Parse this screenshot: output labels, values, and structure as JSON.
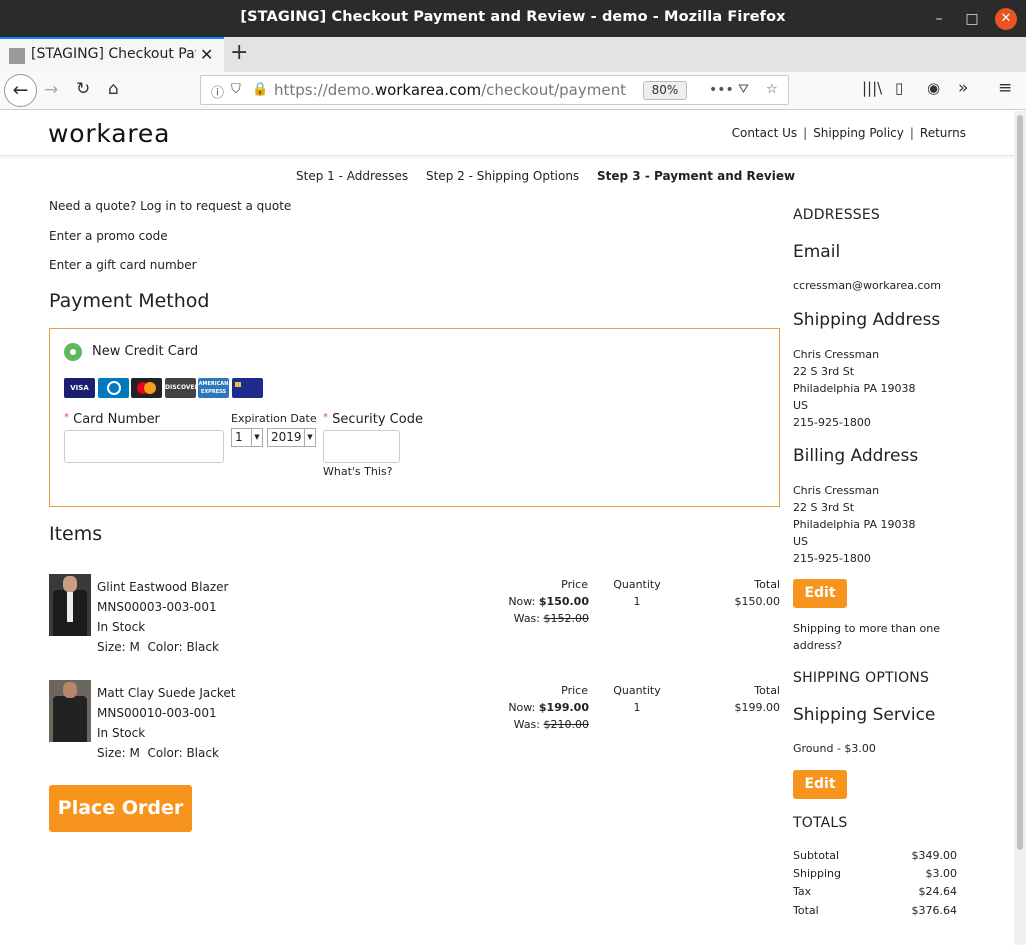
{
  "window": {
    "title": "[STAGING] Checkout Payment and Review - demo - Mozilla Firefox",
    "tab_label": "[STAGING] Checkout Pay",
    "url_prefix": "https://demo.",
    "url_domain": "workarea.com",
    "url_path": "/checkout/payment",
    "zoom": "80%"
  },
  "header": {
    "logo": "workarea",
    "links": [
      "Contact Us",
      "Shipping Policy",
      "Returns"
    ]
  },
  "steps": [
    "Step 1 - Addresses",
    "Step 2 - Shipping Options",
    "Step 3 - Payment and Review"
  ],
  "links": {
    "quote": "Need a quote? Log in to request a quote",
    "promo": "Enter a promo code",
    "gift": "Enter a gift card number"
  },
  "payment": {
    "title": "Payment Method",
    "option": "New Credit Card",
    "cards": [
      "VISA",
      "Diners",
      "Mastercard",
      "DISCOVER",
      "AMERICAN EXPRESS",
      "Card"
    ],
    "card_number_label": "Card Number",
    "expiration_label": "Expiration Date",
    "exp_month": "1",
    "exp_year": "2019",
    "security_label": "Security Code",
    "whats_this": "What's This?"
  },
  "items": {
    "title": "Items",
    "headers": {
      "price": "Price",
      "quantity": "Quantity",
      "total": "Total"
    },
    "list": [
      {
        "name": "Glint Eastwood Blazer",
        "sku": "MNS00003-003-001",
        "stock": "In Stock",
        "options": "Size: M  Color: Black",
        "now_label": "Now:",
        "now": "$150.00",
        "was_label": "Was:",
        "was": "$152.00",
        "quantity": "1",
        "total": "$150.00"
      },
      {
        "name": "Matt Clay Suede Jacket",
        "sku": "MNS00010-003-001",
        "stock": "In Stock",
        "options": "Size: M  Color: Black",
        "now_label": "Now:",
        "now": "$199.00",
        "was_label": "Was:",
        "was": "$210.00",
        "quantity": "1",
        "total": "$199.00"
      }
    ]
  },
  "place_order": "Place Order",
  "sidebar": {
    "addresses_caption": "ADDRESSES",
    "email_heading": "Email",
    "email": "ccressman@workarea.com",
    "shipping_heading": "Shipping Address",
    "shipping_lines": [
      "Chris Cressman",
      "22 S 3rd St",
      "Philadelphia PA 19038",
      "US",
      "215-925-1800"
    ],
    "billing_heading": "Billing Address",
    "billing_lines": [
      "Chris Cressman",
      "22 S 3rd St",
      "Philadelphia PA 19038",
      "US",
      "215-925-1800"
    ],
    "edit": "Edit",
    "multi_ship": "Shipping to more than one address?",
    "shipping_options_caption": "SHIPPING OPTIONS",
    "service_heading": "Shipping Service",
    "service": "Ground - $3.00",
    "totals_caption": "TOTALS",
    "totals": [
      {
        "label": "Subtotal",
        "value": "$349.00"
      },
      {
        "label": "Shipping",
        "value": "$3.00"
      },
      {
        "label": "Tax",
        "value": "$24.64"
      },
      {
        "label": "Total",
        "value": "$376.64"
      }
    ]
  },
  "colors": {
    "accent": "#f7941d",
    "card_border": "#e6a04a",
    "radio": "#5cb85c",
    "close_button": "#e95420"
  }
}
